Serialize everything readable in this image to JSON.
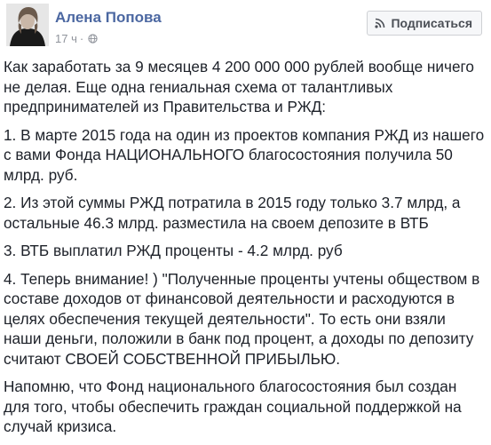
{
  "post": {
    "author": "Алена Попова",
    "time": "17 ч",
    "separator": "·",
    "subscribe_label": "Подписаться",
    "paragraphs": [
      "Как заработать за 9 месяцев 4 200 000 000 рублей вообще ничего не делая. Еще одна гениальная схема от талантливых предпринимателей из Правительства и РЖД:",
      "1. В марте 2015 года на один из проектов компания РЖД из нашего с вами Фонда НАЦИОНАЛЬНОГО благосостояния получила 50 млрд. руб.",
      "2. Из этой суммы РЖД потратила в 2015 году только 3.7 млрд, а остальные 46.3 млрд. разместила на своем депозите в ВТБ",
      "3. ВТБ выплатил РЖД проценты - 4.2 млрд. руб",
      "4. Теперь внимание! ) \"Полученные проценты учтены обществом в составе доходов от финансовой деятельности и расходуются в целях обеспечения текущей деятельности\". То есть они взяли наши деньги, положили в банк под процент, а доходы по депозиту считают СВОЕЙ СОБСТВЕННОЙ ПРИБЫЛЬЮ.",
      "Напомню, что Фонд национального благосостояния был создан для того, чтобы обеспечить граждан социальной поддержкой на случай кризиса."
    ]
  },
  "icons": {
    "avatar": "avatar-photo",
    "privacy": "globe-icon",
    "subscribe": "rss-icon"
  },
  "colors": {
    "author_link": "#4b67a1",
    "meta_text": "#90949c",
    "body_text": "#1d2129",
    "button_bg": "#f6f7f9",
    "button_border": "#ced0d4"
  }
}
